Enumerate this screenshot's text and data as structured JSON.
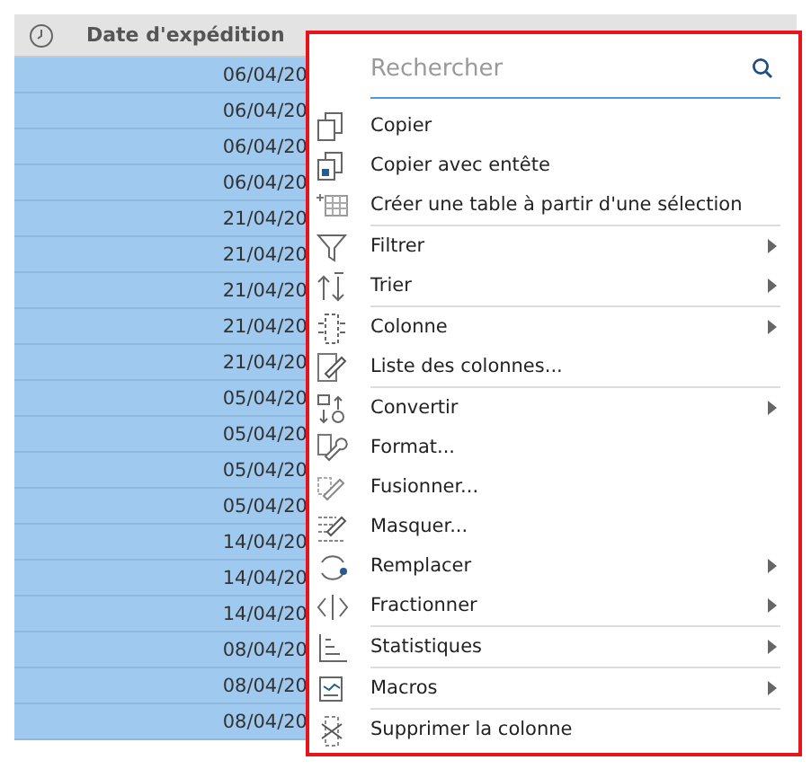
{
  "table": {
    "columns": [
      {
        "label": "Date d'expédition"
      }
    ],
    "rows": [
      {
        "date": "06/04/20",
        "selected": true
      },
      {
        "date": "06/04/20",
        "selected": true
      },
      {
        "date": "06/04/20",
        "selected": true
      },
      {
        "date": "06/04/20",
        "selected": true
      },
      {
        "date": "21/04/20",
        "selected": true
      },
      {
        "date": "21/04/20",
        "selected": true
      },
      {
        "date": "21/04/20",
        "selected": true
      },
      {
        "date": "21/04/20",
        "selected": true
      },
      {
        "date": "21/04/20",
        "selected": true
      },
      {
        "date": "05/04/20",
        "selected": true
      },
      {
        "date": "05/04/20",
        "selected": true
      },
      {
        "date": "05/04/20",
        "selected": true
      },
      {
        "date": "05/04/20",
        "selected": true
      },
      {
        "date": "14/04/20",
        "selected": true
      },
      {
        "date": "14/04/20",
        "selected": true
      },
      {
        "date": "14/04/20",
        "selected": true
      },
      {
        "date": "08/04/20",
        "selected": true
      },
      {
        "date": "08/04/20",
        "selected": true
      },
      {
        "date": "08/04/20",
        "selected": true
      }
    ]
  },
  "context_menu": {
    "search": {
      "placeholder": "Rechercher"
    },
    "groups": [
      [
        {
          "label": "Copier",
          "has_submenu": false
        },
        {
          "label": "Copier avec entête",
          "has_submenu": false
        },
        {
          "label": "Créer une table à partir d'une sélection",
          "has_submenu": false
        }
      ],
      [
        {
          "label": "Filtrer",
          "has_submenu": true
        },
        {
          "label": "Trier",
          "has_submenu": true
        }
      ],
      [
        {
          "label": "Colonne",
          "has_submenu": true
        },
        {
          "label": "Liste des colonnes...",
          "has_submenu": false
        }
      ],
      [
        {
          "label": "Convertir",
          "has_submenu": true
        },
        {
          "label": "Format...",
          "has_submenu": false
        },
        {
          "label": "Fusionner...",
          "has_submenu": false
        },
        {
          "label": "Masquer...",
          "has_submenu": false
        },
        {
          "label": "Remplacer",
          "has_submenu": true
        },
        {
          "label": "Fractionner",
          "has_submenu": true
        }
      ],
      [
        {
          "label": "Statistiques",
          "has_submenu": true
        }
      ],
      [
        {
          "label": "Macros",
          "has_submenu": true
        }
      ],
      [
        {
          "label": "Supprimer la colonne",
          "has_submenu": false
        }
      ]
    ]
  }
}
